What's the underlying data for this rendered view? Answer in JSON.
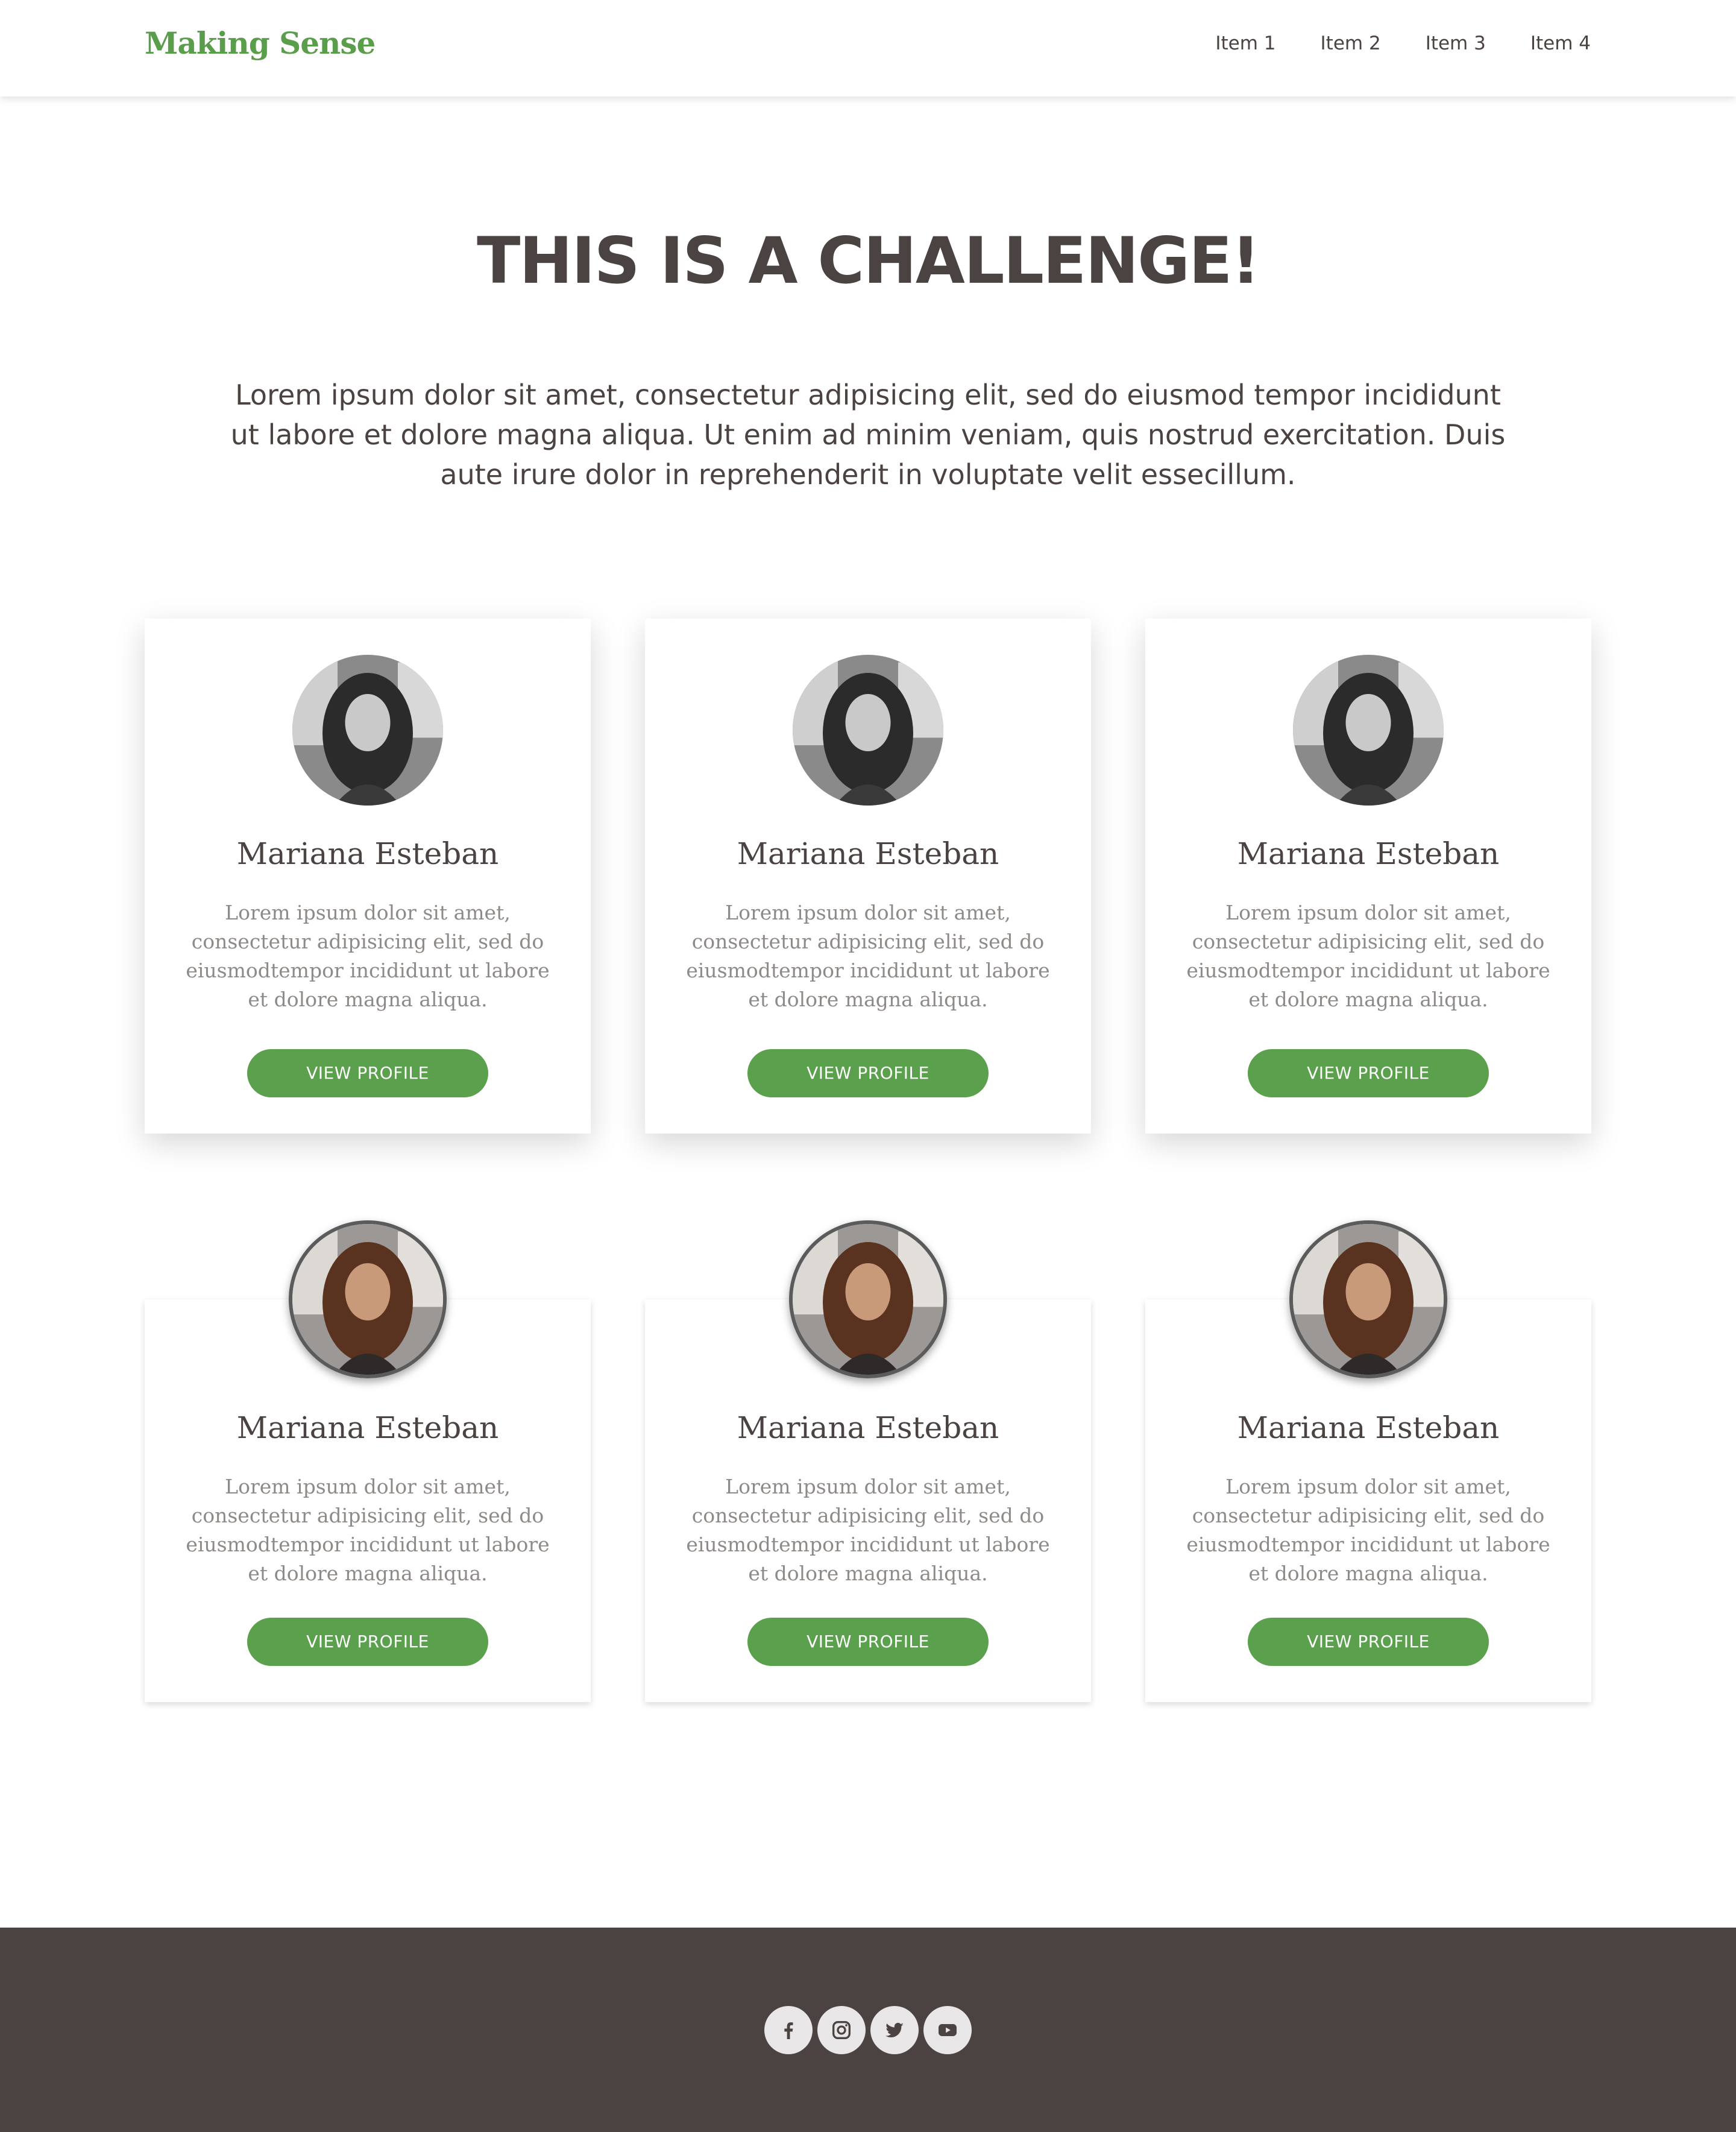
{
  "header": {
    "logo": "Making Sense",
    "nav": [
      "Item 1",
      "Item 2",
      "Item 3",
      "Item 4"
    ]
  },
  "hero": {
    "title": "THIS IS A CHALLENGE!",
    "text": "Lorem ipsum dolor sit amet, consectetur adipisicing elit, sed do eiusmod tempor incididunt ut labore et dolore magna aliqua. Ut enim ad minim veniam, quis nostrud exercitation. Duis aute irure dolor in reprehenderit in voluptate velit essecillum."
  },
  "cards": [
    {
      "name": "Mariana Esteban",
      "text": "Lorem ipsum dolor sit amet, consectetur adipisicing elit, sed do eiusmodtempor incididunt ut labore et dolore magna aliqua.",
      "button": "VIEW PROFILE"
    },
    {
      "name": "Mariana Esteban",
      "text": "Lorem ipsum dolor sit amet, consectetur adipisicing elit, sed do eiusmodtempor incididunt ut labore et dolore magna aliqua.",
      "button": "VIEW PROFILE"
    },
    {
      "name": "Mariana Esteban",
      "text": "Lorem ipsum dolor sit amet, consectetur adipisicing elit, sed do eiusmodtempor incididunt ut labore et dolore magna aliqua.",
      "button": "VIEW PROFILE"
    },
    {
      "name": "Mariana Esteban",
      "text": "Lorem ipsum dolor sit amet, consectetur adipisicing elit, sed do eiusmodtempor incididunt ut labore et dolore magna aliqua.",
      "button": "VIEW PROFILE"
    },
    {
      "name": "Mariana Esteban",
      "text": "Lorem ipsum dolor sit amet, consectetur adipisicing elit, sed do eiusmodtempor incididunt ut labore et dolore magna aliqua.",
      "button": "VIEW PROFILE"
    },
    {
      "name": "Mariana Esteban",
      "text": "Lorem ipsum dolor sit amet, consectetur adipisicing elit, sed do eiusmodtempor incididunt ut labore et dolore magna aliqua.",
      "button": "VIEW PROFILE"
    }
  ],
  "footer": {
    "social_icons": [
      "facebook-icon",
      "instagram-icon",
      "twitter-icon",
      "youtube-icon"
    ]
  },
  "colors": {
    "brand_green": "#5ba04c",
    "text_dark": "#4a4341",
    "text_muted": "#8e8a88",
    "footer_bg": "#4b4341"
  }
}
